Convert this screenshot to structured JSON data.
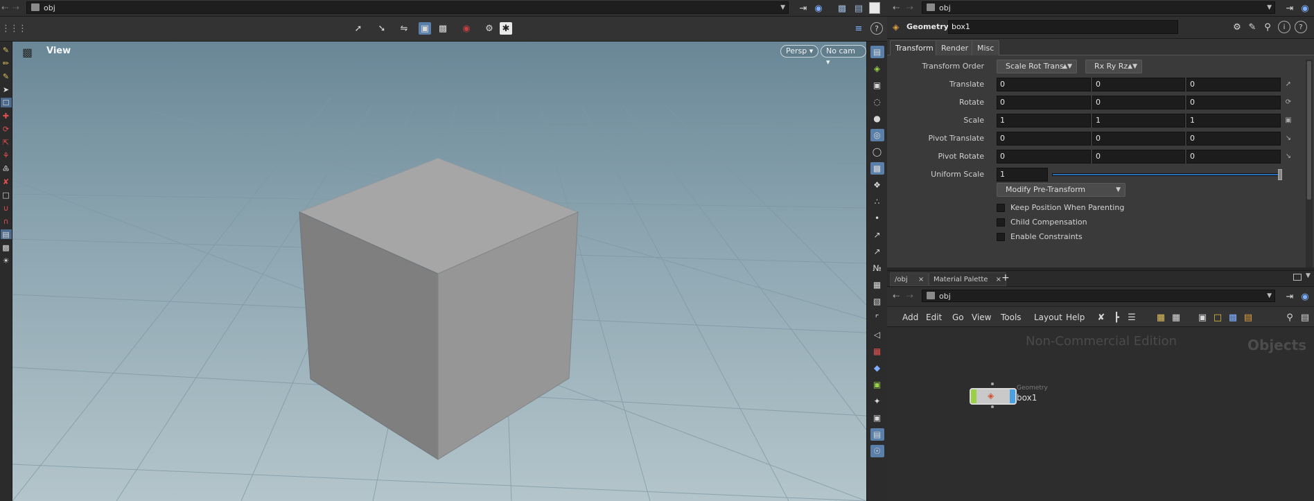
{
  "left_pane": {
    "path_label": "obj",
    "viewport_title": "View",
    "persp_label": "Persp ▾",
    "cam_label": "No cam ▾"
  },
  "right_top": {
    "path_label": "obj",
    "node_type": "Geometry",
    "node_name": "box1",
    "tabs": [
      "Transform",
      "Render",
      "Misc"
    ],
    "transform_order": "Scale Rot Trans",
    "rotate_order": "Rx Ry Rz",
    "params": [
      {
        "label": "Translate",
        "values": [
          "0",
          "0",
          "0"
        ]
      },
      {
        "label": "Rotate",
        "values": [
          "0",
          "0",
          "0"
        ]
      },
      {
        "label": "Scale",
        "values": [
          "1",
          "1",
          "1"
        ]
      },
      {
        "label": "Pivot Translate",
        "values": [
          "0",
          "0",
          "0"
        ]
      },
      {
        "label": "Pivot Rotate",
        "values": [
          "0",
          "0",
          "0"
        ]
      }
    ],
    "transform_order_label": "Transform Order",
    "uniform_scale_label": "Uniform Scale",
    "uniform_scale_value": "1",
    "uniform_scale_level": 1.0,
    "modify_label": "Modify Pre-Transform",
    "checkboxes": [
      "Keep Position When Parenting",
      "Child Compensation",
      "Enable Constraints"
    ]
  },
  "right_bottom": {
    "tabs": [
      "/obj",
      "Material Palette"
    ],
    "path_label": "obj",
    "menu": [
      "Add",
      "Edit",
      "Go",
      "View",
      "Tools",
      "Layout",
      "Help"
    ],
    "watermark": "Non-Commercial Edition",
    "context_label": "Objects",
    "node_type": "Geometry",
    "node_name": "box1"
  },
  "colors": {
    "viewport_top": "#6a8797",
    "viewport_bottom": "#b4c5cb",
    "node_blue": "#4aa0e0",
    "node_green": "#9ad048",
    "slider_blue": "#2a6fb8"
  }
}
